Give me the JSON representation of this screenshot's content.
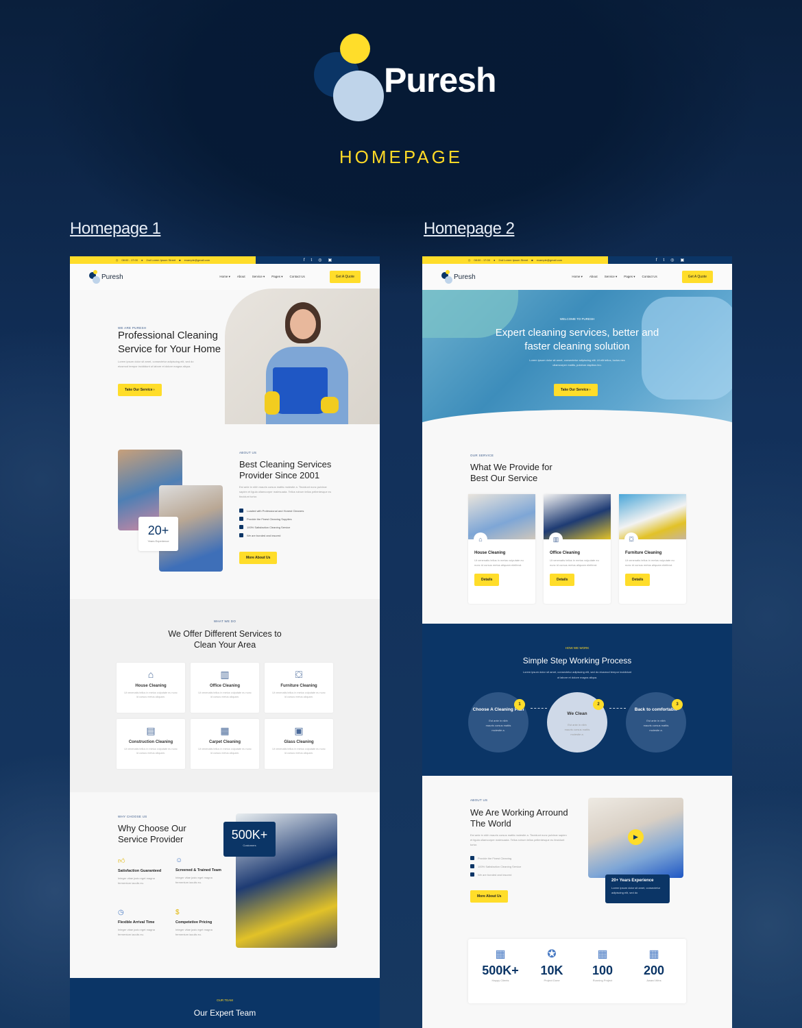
{
  "brand": {
    "name": "Puresh",
    "page_label": "HOMEPAGE",
    "colors": {
      "primary": "#0b3566",
      "accent": "#ffdd2a",
      "light": "#bfd4ea"
    }
  },
  "links": {
    "homepage1": "Homepage 1",
    "homepage2": "Homepage 2"
  },
  "header": {
    "hours": "08:00 - 17:00",
    "address": "2nd Lorem Ipsum Street",
    "email": "example@gmail.com",
    "socials": [
      "facebook-icon",
      "twitter-icon",
      "instagram-icon",
      "linkedin-icon"
    ],
    "logo": "Puresh",
    "menu": [
      "Home ▾",
      "About",
      "Service ▾",
      "Pages ▾",
      "Contact Us"
    ],
    "cta": "Get A Quote"
  },
  "hp1": {
    "hero": {
      "eyebrow": "WE ARE PURESH",
      "title": "Professional Cleaning Service for Your Home",
      "text": "Lorem ipsum dolor sit amet, consectetur adipiscing elit, sed do eiusmod tempor incididunt ut labore et dolore magna aliqua.",
      "button": "Take Our Service ›"
    },
    "about": {
      "eyebrow": "ABOUT US",
      "title": "Best Cleaning Services Provider Since 2001",
      "text": "Est ante in nibh mauris cursus mattis molestie a. Tincidunt nunc pulvinar sapien et ligula ullamcorper malesuada. Tellus rutrum tellus pellentesque eu tincidunt tortor.",
      "checks": [
        "Loaded with Professional and Honest Cleaners",
        "Provide the Finest Cleaning Supplies",
        "100% Satisfaction Cleaning Service",
        "We are bonded and insured"
      ],
      "badge_value": "20+",
      "badge_label": "Years Experience",
      "button": "More About Us"
    },
    "services": {
      "eyebrow": "WHAT WE DO",
      "title": "We Offer Different Services to Clean Your Area",
      "items": [
        {
          "icon": "house-icon",
          "title": "House Cleaning",
          "text": "Ut venenatis tellus in metus vulputate eu nunc id cursus metus aliquam."
        },
        {
          "icon": "office-icon",
          "title": "Office Cleaning",
          "text": "Ut venenatis tellus in metus vulputate eu nunc id cursus metus aliquam."
        },
        {
          "icon": "furniture-icon",
          "title": "Furniture Cleaning",
          "text": "Ut venenatis tellus in metus vulputate eu nunc id cursus metus aliquam."
        },
        {
          "icon": "construction-icon",
          "title": "Construction Cleaning",
          "text": "Ut venenatis tellus in metus vulputate eu nunc id cursus metus aliquam."
        },
        {
          "icon": "carpet-icon",
          "title": "Carpet Cleaning",
          "text": "Ut venenatis tellus in metus vulputate eu nunc id cursus metus aliquam."
        },
        {
          "icon": "glass-icon",
          "title": "Glass Cleaning",
          "text": "Ut venenatis tellus in metus vulputate eu nunc id cursus metus aliquam."
        }
      ]
    },
    "why": {
      "eyebrow": "WHY CHOOSE US",
      "title": "Why Choose Our Service Provider",
      "stat_value": "500K+",
      "stat_label": "Customers",
      "items": [
        {
          "title": "Satisfaction Guaranteed",
          "text": "Integer vitae justo eget magna fermentum iaculis eu."
        },
        {
          "title": "Screened & Trained Team",
          "text": "Integer vitae justo eget magna fermentum iaculis eu."
        },
        {
          "title": "Flexible Arrival Time",
          "text": "Integer vitae justo eget magna fermentum iaculis eu."
        },
        {
          "title": "Competetive Pricing",
          "text": "Integer vitae justo eget magna fermentum iaculis eu."
        }
      ]
    },
    "team": {
      "eyebrow": "OUR TEAM",
      "title": "Our Expert Team"
    }
  },
  "hp2": {
    "hero": {
      "eyebrow": "WELCOME TO PURESH",
      "title": "Expert cleaning services, better and faster cleaning solution",
      "text": "Lorem ipsum dolor sit amet, consectetur adipiscing elit. Ut elit tellus, luctus nec ullamcorper mattis, pulvinar dapibus leo.",
      "button": "Take Our Service ›"
    },
    "services": {
      "eyebrow": "OUR SERVICE",
      "title": "What We Provide for Best Our Service",
      "items": [
        {
          "title": "House Cleaning",
          "text": "Ut venenatis tellus in metus vulputate eu nunc id cursus metus aliquam eleifend.",
          "button": "Details"
        },
        {
          "title": "Office Cleaning",
          "text": "Ut venenatis tellus in metus vulputate eu nunc id cursus metus aliquam eleifend.",
          "button": "Details"
        },
        {
          "title": "Furniture Cleaning",
          "text": "Ut venenatis tellus in metus vulputate eu nunc id cursus metus aliquam eleifend.",
          "button": "Details"
        }
      ]
    },
    "process": {
      "eyebrow": "HOW WE WORK",
      "title": "Simple Step Working Process",
      "text": "Lorem ipsum dolor sit amet, consectetur adipiscing elit, sed do eiusmod tempor incididunt ut labore et dolore magna aliqua.",
      "steps": [
        {
          "num": "1",
          "title": "Choose A Cleaning Plan",
          "text": "Est ante in nibh mauris cursus mattis molestie a."
        },
        {
          "num": "2",
          "title": "We Clean",
          "text": "Est ante in nibh mauris cursus mattis molestie a."
        },
        {
          "num": "3",
          "title": "Back to comfortable",
          "text": "Est ante in nibh mauris cursus mattis molestie a."
        }
      ]
    },
    "about": {
      "eyebrow": "ABOUT US",
      "title": "We Are Working Arround The World",
      "text": "Est ante in nibh mauris cursus mattis molestie a. Tincidunt nunc pulvinar sapien et ligula ullamcorper malesuada. Tellus rutrum tellus pellentesque eu tincidunt tortor.",
      "checks": [
        "Provide the Finest Cleaning",
        "100% Satisfaction Cleaning Service",
        "We are bonded and insured"
      ],
      "button": "More About Us",
      "exp_title": "20+ Years Experience",
      "exp_text": "Lorem ipsum dolor sit amet, consectetur adipiscing elit, sed do"
    },
    "stats": [
      {
        "value": "500K+",
        "label": "Happy Clients"
      },
      {
        "value": "10K",
        "label": "Project Done"
      },
      {
        "value": "100",
        "label": "Running Project"
      },
      {
        "value": "200",
        "label": "Award Wins"
      }
    ]
  }
}
